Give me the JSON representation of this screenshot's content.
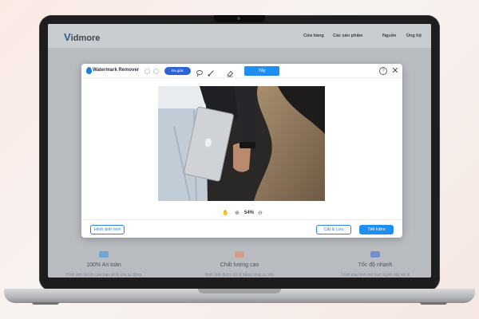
{
  "website": {
    "logo_text": "idmore",
    "nav": [
      "Cửa hàng",
      "Các sản phẩm",
      "Nguồn",
      "Ủng hộ"
    ],
    "features": [
      {
        "title": "100% An toàn",
        "desc": "Hình ảnh tải lên của bạn sẽ bị xóa tự động",
        "color": "#2c8fd6"
      },
      {
        "title": "Chất lượng cao",
        "desc": "Hình ảnh được xử lý bằng công cụ xóa",
        "color": "#e8804f"
      },
      {
        "title": "Tốc độ nhanh",
        "desc": "Trình xóa hình mờ trực tuyến này xử lý",
        "color": "#2e63d8"
      }
    ]
  },
  "dialog": {
    "title": "Watermark Remover",
    "tool_pill": "Đa giác",
    "erase_button": "Tẩy",
    "help_icon": "?",
    "close_icon": "✕",
    "zoom": "54%",
    "new_image_button": "Hình ảnh mới",
    "crop_save_button": "Cắt & Lưu",
    "save_button": "Tiết kiệm"
  },
  "colors": {
    "accent": "#1e8ff0",
    "pill": "#2e63d8"
  }
}
